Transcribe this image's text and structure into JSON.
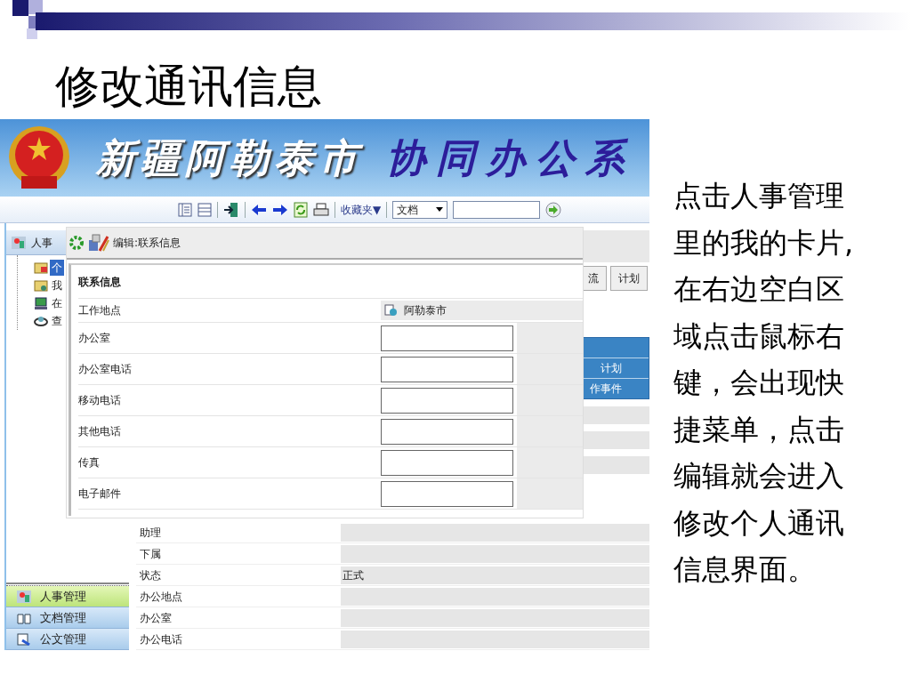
{
  "slide": {
    "title": "修改通讯信息",
    "body": "点击人事管理里的我的卡片,在右边空白区域点击鼠标右键，会出现快捷菜单，点击编辑就会进入修改个人通讯信息界面。"
  },
  "app": {
    "banner": {
      "city": "新疆阿勒泰市",
      "system": "协同办公系"
    },
    "toolbar": {
      "favorites": "收藏夹▼",
      "search_scope": "文档"
    },
    "sidebar": {
      "tab": "人事",
      "tree": [
        {
          "label": "个",
          "selected": true
        },
        {
          "label": "我",
          "selected": false
        },
        {
          "label": "在",
          "selected": false
        },
        {
          "label": "查",
          "selected": false
        }
      ],
      "modules": [
        {
          "label": "人事管理",
          "selected": true
        },
        {
          "label": "文档管理",
          "selected": false
        },
        {
          "label": "公文管理",
          "selected": false
        }
      ]
    },
    "main": {
      "tabs": [
        "流",
        "计划"
      ],
      "list": [
        "计划",
        "作事件"
      ],
      "rows": [
        {
          "label": "助理"
        },
        {
          "label": "下属"
        },
        {
          "label": "状态",
          "value": "正式"
        },
        {
          "label": "办公地点"
        },
        {
          "label": "办公室"
        },
        {
          "label": "办公电话"
        }
      ]
    },
    "dialog": {
      "title": "编辑:联系信息",
      "section": "联系信息",
      "fields": [
        {
          "label": "工作地点",
          "kind": "text",
          "value": "阿勒泰市"
        },
        {
          "label": "办公室",
          "kind": "input"
        },
        {
          "label": "办公室电话",
          "kind": "input"
        },
        {
          "label": "移动电话",
          "kind": "input"
        },
        {
          "label": "其他电话",
          "kind": "input"
        },
        {
          "label": "传真",
          "kind": "input"
        },
        {
          "label": "电子邮件",
          "kind": "input"
        }
      ]
    }
  }
}
